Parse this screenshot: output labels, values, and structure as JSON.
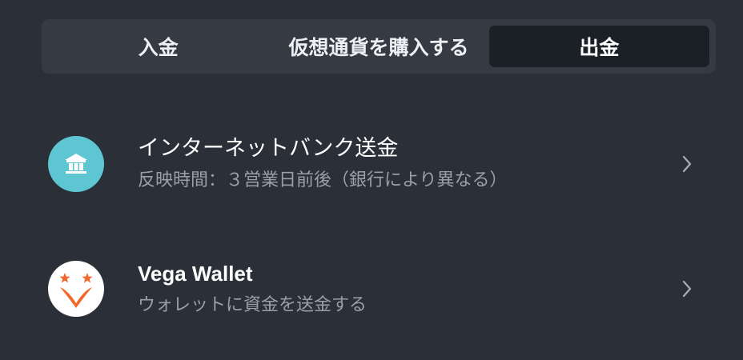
{
  "tabs": [
    {
      "label": "入金",
      "active": false
    },
    {
      "label": "仮想通貨を購入する",
      "active": false
    },
    {
      "label": "出金",
      "active": true
    }
  ],
  "options": [
    {
      "title": "インターネットバンク送金",
      "subtitle": "反映時間：３営業日前後（銀行により異なる）",
      "icon": "bank-icon",
      "icon_bg": "#5ec6d3"
    },
    {
      "title": "Vega Wallet",
      "subtitle": "ウォレットに資金を送金する",
      "icon": "vega-wallet-logo-icon",
      "icon_bg": "#ffffff"
    }
  ],
  "colors": {
    "background": "#2b2f37",
    "tab_bar": "#353a43",
    "tab_active": "#1b1f26",
    "subtitle_text": "#9a9fa8",
    "vega_orange": "#f0682b"
  }
}
